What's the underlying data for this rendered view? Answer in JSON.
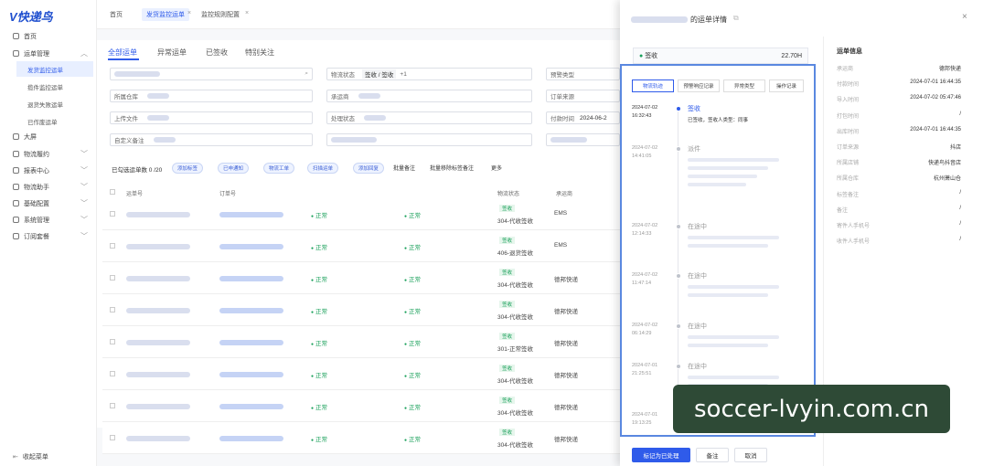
{
  "app": {
    "logo": "V快递鸟",
    "collapse": "收起菜单"
  },
  "sidebar": {
    "items": [
      {
        "label": "首页"
      },
      {
        "label": "运单管理"
      },
      {
        "label": "大屏"
      },
      {
        "label": "物流履约"
      },
      {
        "label": "报表中心"
      },
      {
        "label": "物流助手"
      },
      {
        "label": "基础配置"
      },
      {
        "label": "系统管理"
      },
      {
        "label": "订阅套餐"
      }
    ],
    "sub": [
      {
        "label": "发货监控运单"
      },
      {
        "label": "揽件监控运单"
      },
      {
        "label": "退货失败运单"
      },
      {
        "label": "已作废运单"
      }
    ]
  },
  "breadcrumb": [
    "首页",
    "发货监控运单",
    "监控规则配置"
  ],
  "tabs": [
    "全部运单",
    "异常运单",
    "已签收",
    "特别关注"
  ],
  "filters": {
    "logistics_status": "物流状态",
    "logistics_status_value": "签收 / 签收",
    "plus": "+1",
    "warn_type": "预警类型",
    "warehouse": "所属仓库",
    "carrier": "承运商",
    "order_source": "订单来源",
    "upload": "上传文件",
    "handle_status": "处理状态",
    "pay_time": "付款时间",
    "pay_time_value": "2024-06-2",
    "custom_remark": "自定义备注"
  },
  "toolbar": {
    "selected": "已勾选运单数 0 /20",
    "buttons": [
      "添加标签",
      "已申通知",
      "物流工单",
      "扫描运单",
      "添加回复"
    ],
    "links": [
      "批量备注",
      "批量移除标签备注",
      "更多"
    ]
  },
  "table": {
    "headers": [
      "运单号",
      "订单号",
      "物流状态",
      "承运商"
    ],
    "rows": [
      {
        "s1": "正常",
        "s2": "正常",
        "tag": "签收",
        "code": "304-代收签收",
        "carrier": "EMS"
      },
      {
        "s1": "正常",
        "s2": "正常",
        "tag": "签收",
        "code": "406-退货签收",
        "carrier": "EMS"
      },
      {
        "s1": "正常",
        "s2": "正常",
        "tag": "签收",
        "code": "304-代收签收",
        "carrier": "德邦快递"
      },
      {
        "s1": "正常",
        "s2": "正常",
        "tag": "签收",
        "code": "304-代收签收",
        "carrier": "德邦快递"
      },
      {
        "s1": "正常",
        "s2": "正常",
        "tag": "签收",
        "code": "301-正常签收",
        "carrier": "德邦快递"
      },
      {
        "s1": "正常",
        "s2": "正常",
        "tag": "签收",
        "code": "304-代收签收",
        "carrier": "德邦快递"
      },
      {
        "s1": "正常",
        "s2": "正常",
        "tag": "签收",
        "code": "304-代收签收",
        "carrier": "德邦快递"
      },
      {
        "s1": "正常",
        "s2": "正常",
        "tag": "签收",
        "code": "304-代收签收",
        "carrier": "德邦快递"
      }
    ]
  },
  "panel": {
    "title": "的运单详情",
    "status": "签收",
    "duration": "22.70H",
    "tabs": [
      "物流轨迹",
      "预警响应记录",
      "异常类型",
      "操作记录"
    ],
    "timeline": [
      {
        "date": "2024-07-02",
        "time": "16:32:43",
        "title": "签收",
        "text": "已签收，签收人类型：同事"
      },
      {
        "date": "2024-07-02",
        "time": "14:41:05",
        "title": "派件",
        "text": ""
      },
      {
        "date": "2024-07-02",
        "time": "12:14:33",
        "title": "在途中",
        "text": ""
      },
      {
        "date": "2024-07-02",
        "time": "11:47:14",
        "title": "在途中",
        "text": ""
      },
      {
        "date": "2024-07-02",
        "time": "06:14:29",
        "title": "在途中",
        "text": ""
      },
      {
        "date": "2024-07-01",
        "time": "21:25:51",
        "title": "在途中",
        "text": ""
      },
      {
        "date": "2024-07-01",
        "time": "19:13:25",
        "title": "",
        "text": ""
      }
    ],
    "info_title": "运单信息",
    "info": [
      {
        "k": "承运商",
        "v": "德邦快递"
      },
      {
        "k": "付款时间",
        "v": "2024-07-01 16:44:35"
      },
      {
        "k": "导入时间",
        "v": "2024-07-02 05:47:46"
      },
      {
        "k": "打包时间",
        "v": "/"
      },
      {
        "k": "出库时间",
        "v": "2024-07-01 16:44:35"
      },
      {
        "k": "订单来源",
        "v": "抖店"
      },
      {
        "k": "所属店铺",
        "v": "快递鸟抖音店"
      },
      {
        "k": "所属仓库",
        "v": "杭州萧山仓"
      },
      {
        "k": "标签备注",
        "v": "/"
      },
      {
        "k": "备注",
        "v": "/"
      },
      {
        "k": "寄件人手机号",
        "v": "/"
      },
      {
        "k": "收件人手机号",
        "v": "/"
      }
    ],
    "footer": {
      "primary": "标记为已处理",
      "remark": "备注",
      "cancel": "取消"
    }
  },
  "watermark": "soccer-lvyin.com.cn"
}
